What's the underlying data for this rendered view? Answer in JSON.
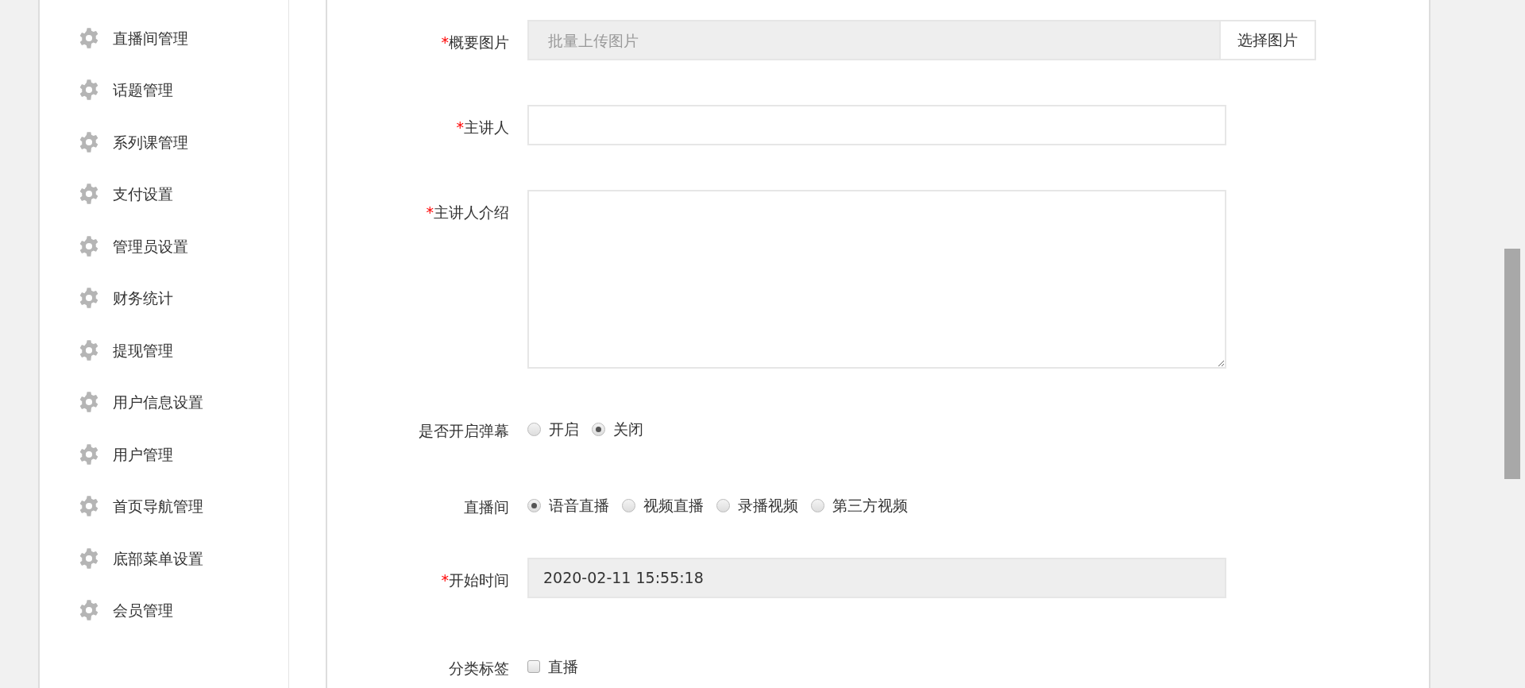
{
  "sidebar": {
    "items": [
      {
        "label": "直播间管理"
      },
      {
        "label": "话题管理"
      },
      {
        "label": "系列课管理"
      },
      {
        "label": "支付设置"
      },
      {
        "label": "管理员设置"
      },
      {
        "label": "财务统计"
      },
      {
        "label": "提现管理"
      },
      {
        "label": "用户信息设置"
      },
      {
        "label": "用户管理"
      },
      {
        "label": "首页导航管理"
      },
      {
        "label": "底部菜单设置"
      },
      {
        "label": "会员管理"
      }
    ]
  },
  "form": {
    "fields": [
      {
        "kind": "upload",
        "required_mark": "*",
        "label": "概要图片",
        "placeholder": "批量上传图片",
        "button": "选择图片"
      },
      {
        "kind": "text",
        "required_mark": "*",
        "label": "主讲人"
      },
      {
        "kind": "textarea",
        "required_mark": "*",
        "label": "主讲人介绍"
      },
      {
        "kind": "radio",
        "label": "是否开启弹幕",
        "options": [
          {
            "label": "开启",
            "selected": false
          },
          {
            "label": "关闭",
            "selected": true
          }
        ]
      },
      {
        "kind": "radio",
        "label": "直播间",
        "options": [
          {
            "label": "语音直播",
            "selected": true
          },
          {
            "label": "视频直播",
            "selected": false
          },
          {
            "label": "录播视频",
            "selected": false
          },
          {
            "label": "第三方视频",
            "selected": false
          }
        ]
      },
      {
        "kind": "readonly",
        "required_mark": "*",
        "label": "开始时间",
        "value": "2020-02-11 15:55:18"
      },
      {
        "kind": "checkbox",
        "label": "分类标签",
        "options": [
          {
            "label": "直播",
            "checked": false
          }
        ]
      }
    ]
  }
}
